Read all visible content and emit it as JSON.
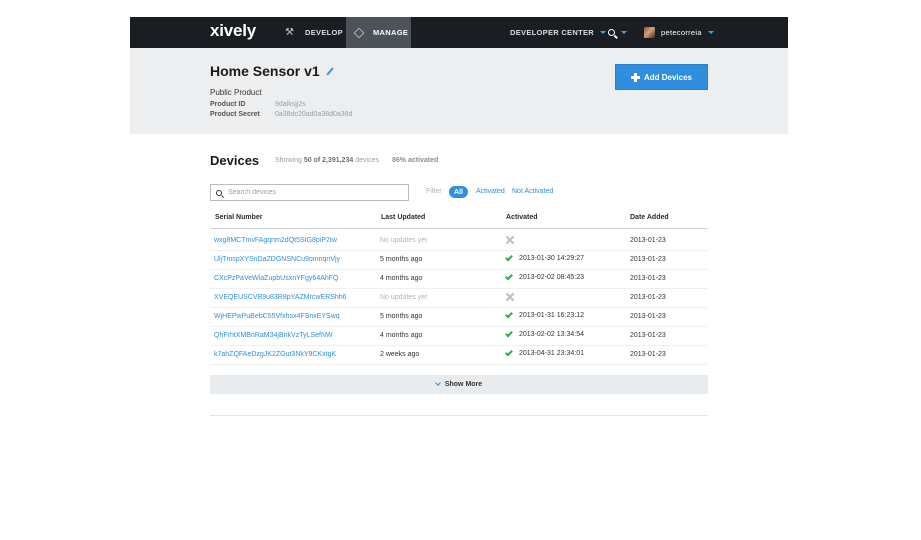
{
  "navbar": {
    "logo": "xively",
    "develop": "DEVELOP",
    "manage": "MANAGE",
    "developer_center": "DEVELOPER CENTER",
    "username": "petecorreia",
    "icons": [
      "wrench-icon",
      "stack-icon",
      "search-icon",
      "chevron-down-icon",
      "avatar"
    ]
  },
  "product": {
    "title": "Home Sensor v1",
    "type": "Public Product",
    "id_label": "Product ID",
    "id_value": "9dalksjj2s",
    "secret_label": "Product Secret",
    "secret_value": "0a38dc20ad0a38d0a38d",
    "add_button": "Add Devices"
  },
  "devices": {
    "title": "Devices",
    "showing_prefix": "Showing",
    "showing_count": "50 of 2,391,234",
    "showing_suffix": "devices",
    "activated_pct": "86% activated",
    "search_placeholder": "Search devices",
    "filter_label": "Filter",
    "filters": {
      "all": "All",
      "activated": "Activated",
      "not_activated": "Not Activated"
    },
    "columns": {
      "serial": "Serial Number",
      "updated": "Last Updated",
      "activated": "Activated",
      "date_added": "Date Added"
    },
    "rows": [
      {
        "serial": "wxg8MCTmvFAgqnm2dQt5StG8piP2tw",
        "updated": "No updates yet",
        "activated": "",
        "date_added": "2013-01-23"
      },
      {
        "serial": "UljTmspXYSnDaZDGNSNCu9omnqnVjy",
        "updated": "5 months ago",
        "activated": "2013-01-30 14:29:27",
        "date_added": "2013-01-23"
      },
      {
        "serial": "CXcPzPaVeWiaZupbUsxnYFgy64AhFQ",
        "updated": "4 months ago",
        "activated": "2013-02-02 08:45:23",
        "date_added": "2013-01-23"
      },
      {
        "serial": "XVEQEUSCVB9u83R8pYAZMrcwERShh6",
        "updated": "No updates yet",
        "activated": "",
        "date_added": "2013-01-23"
      },
      {
        "serial": "WjHEPwPuBebC55Vfxhsx4FSnxEYSwq",
        "updated": "5 months ago",
        "activated": "2013-01-31 16:23:12",
        "date_added": "2013-01-23"
      },
      {
        "serial": "QhFrhtXMBnRaM34jBnkVzTyLSefNW",
        "updated": "4 months ago",
        "activated": "2013-02-02 13:34:54",
        "date_added": "2013-01-23"
      },
      {
        "serial": "k7ahZQFAeDzgJK2ZGut3NkY9CKxtgK",
        "updated": "2 weeks ago",
        "activated": "2013-04-31 23:34:01",
        "date_added": "2013-01-23"
      }
    ],
    "show_more": "Show More"
  },
  "colors": {
    "accent": "#2f8fde",
    "navbar": "#1a1e22",
    "header_bg": "#eceef0",
    "check": "#2eaa55"
  }
}
